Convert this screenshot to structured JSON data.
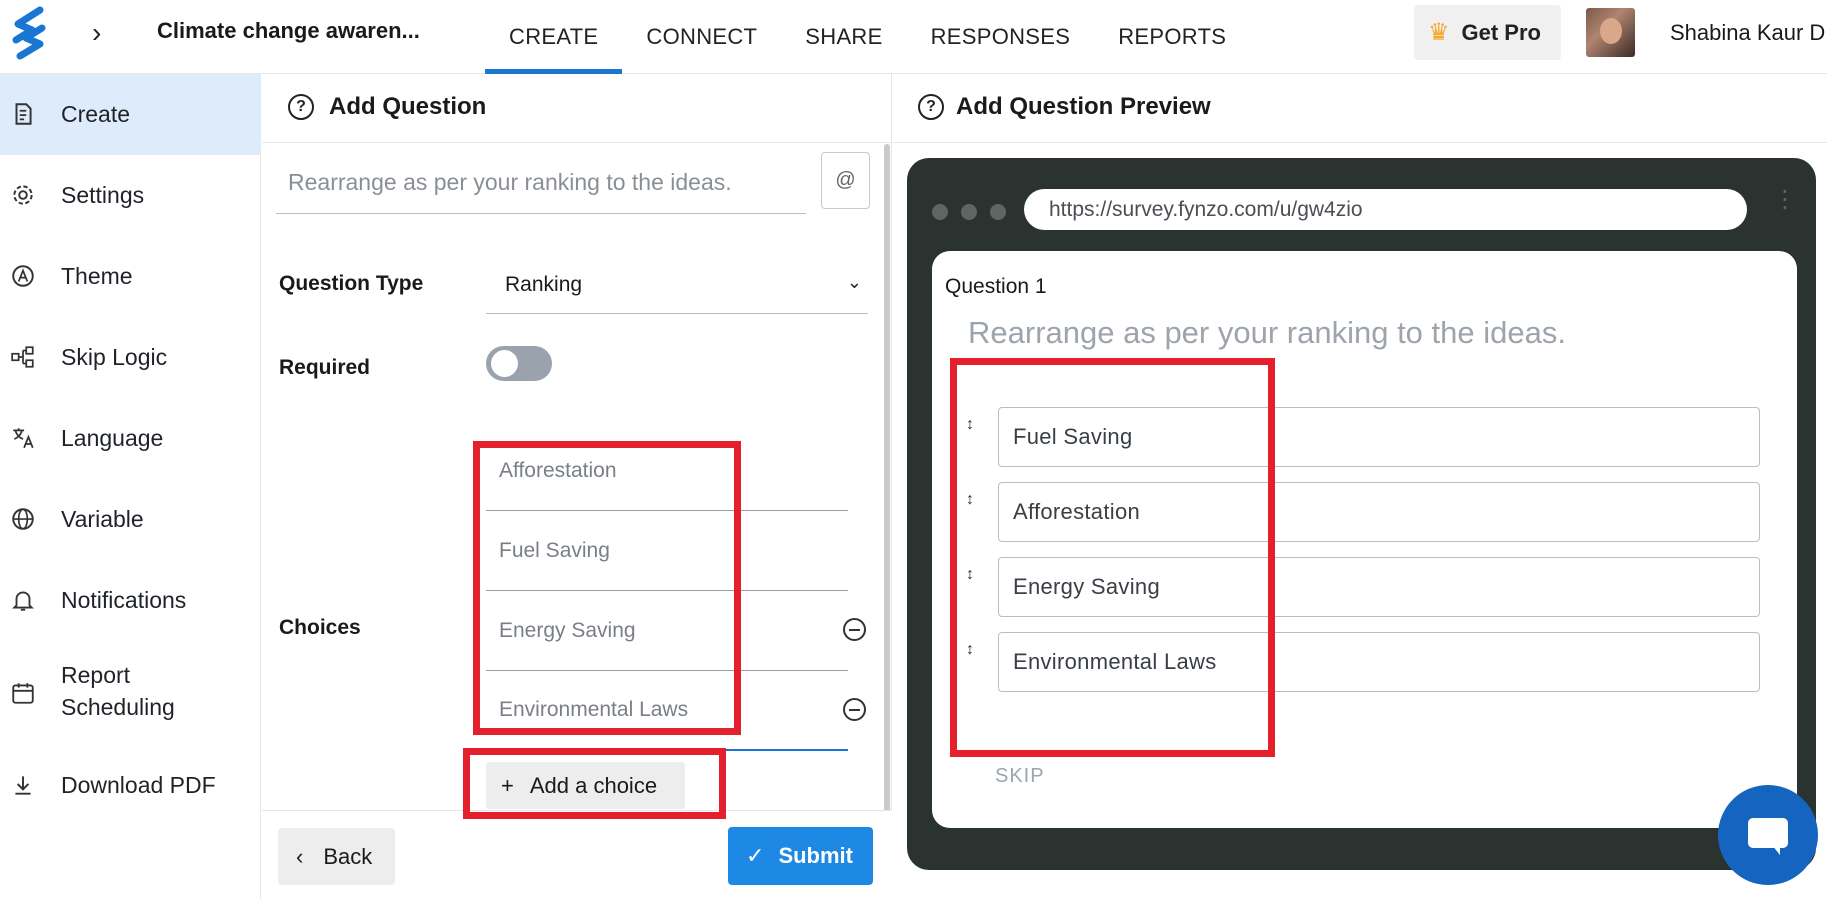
{
  "header": {
    "survey_title": "Climate change awaren...",
    "tabs": [
      {
        "label": "CREATE",
        "active": true
      },
      {
        "label": "CONNECT",
        "active": false
      },
      {
        "label": "SHARE",
        "active": false
      },
      {
        "label": "RESPONSES",
        "active": false
      },
      {
        "label": "REPORTS",
        "active": false
      }
    ],
    "get_pro_label": "Get Pro",
    "user_name": "Shabina Kaur D"
  },
  "sidebar": {
    "items": [
      {
        "label": "Create",
        "icon": "document-icon",
        "active": true
      },
      {
        "label": "Settings",
        "icon": "gear-icon"
      },
      {
        "label": "Theme",
        "icon": "theme-icon"
      },
      {
        "label": "Skip Logic",
        "icon": "flow-icon"
      },
      {
        "label": "Language",
        "icon": "translate-icon"
      },
      {
        "label": "Variable",
        "icon": "globe-icon"
      },
      {
        "label": "Notifications",
        "icon": "bell-icon"
      },
      {
        "label": "Report Scheduling",
        "icon": "calendar-icon"
      },
      {
        "label": "Download PDF",
        "icon": "download-icon"
      }
    ]
  },
  "editor": {
    "title": "Add Question",
    "question_placeholder": "Rearrange as per your ranking to the ideas.",
    "at_label": "@",
    "question_type_label": "Question Type",
    "question_type_value": "Ranking",
    "required_label": "Required",
    "required_on": false,
    "choices_label": "Choices",
    "choices": [
      "Afforestation",
      "Fuel Saving",
      "Energy Saving",
      "Environmental Laws"
    ],
    "add_choice_label": "Add a choice",
    "back_label": "Back",
    "submit_label": "Submit"
  },
  "preview": {
    "title": "Add Question Preview",
    "url": "https://survey.fynzo.com/u/gw4zio",
    "question_number": "Question 1",
    "question_text": "Rearrange as per your ranking to the ideas.",
    "ranked_items": [
      "Fuel Saving",
      "Afforestation",
      "Energy Saving",
      "Environmental Laws"
    ],
    "skip_label": "SKIP"
  },
  "colors": {
    "accent": "#1976d2",
    "highlight": "#e3202b",
    "browser_frame": "#2a3330"
  }
}
